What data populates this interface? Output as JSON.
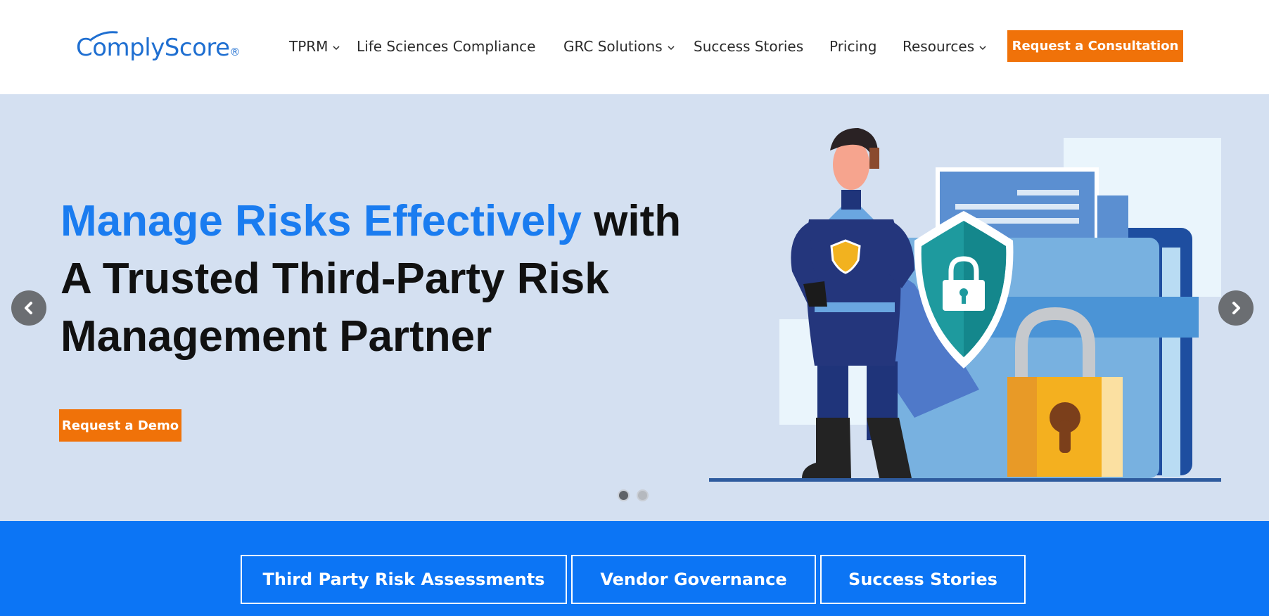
{
  "brand": {
    "name": "ComplyScore",
    "registered": "®",
    "color": "#1f6fd1"
  },
  "nav": {
    "items": [
      {
        "label": "TPRM",
        "has_dropdown": true
      },
      {
        "label": "Life Sciences Compliance",
        "has_dropdown": false
      },
      {
        "label": "GRC Solutions",
        "has_dropdown": true
      },
      {
        "label": "Success Stories",
        "has_dropdown": false
      },
      {
        "label": "Pricing",
        "has_dropdown": false
      },
      {
        "label": "Resources",
        "has_dropdown": true
      }
    ],
    "cta_label": "Request a Consultation"
  },
  "hero": {
    "headline_highlight": "Manage Risks Effectively",
    "headline_rest_1": "with",
    "headline_line2": "A Trusted Third-Party Risk",
    "headline_line3": "Management Partner",
    "demo_button_label": "Request a Demo",
    "slides_total": 2,
    "active_slide": 1,
    "prev_icon": "chevron-left-icon",
    "next_icon": "chevron-right-icon"
  },
  "quick_links": [
    {
      "label": "Third Party Risk Assessments"
    },
    {
      "label": "Vendor Governance"
    },
    {
      "label": "Success Stories"
    }
  ],
  "colors": {
    "accent_orange": "#f07209",
    "hero_bg": "#d4e0f1",
    "strip_bg": "#0c75f5",
    "headline_blue": "#1a7cf0"
  }
}
